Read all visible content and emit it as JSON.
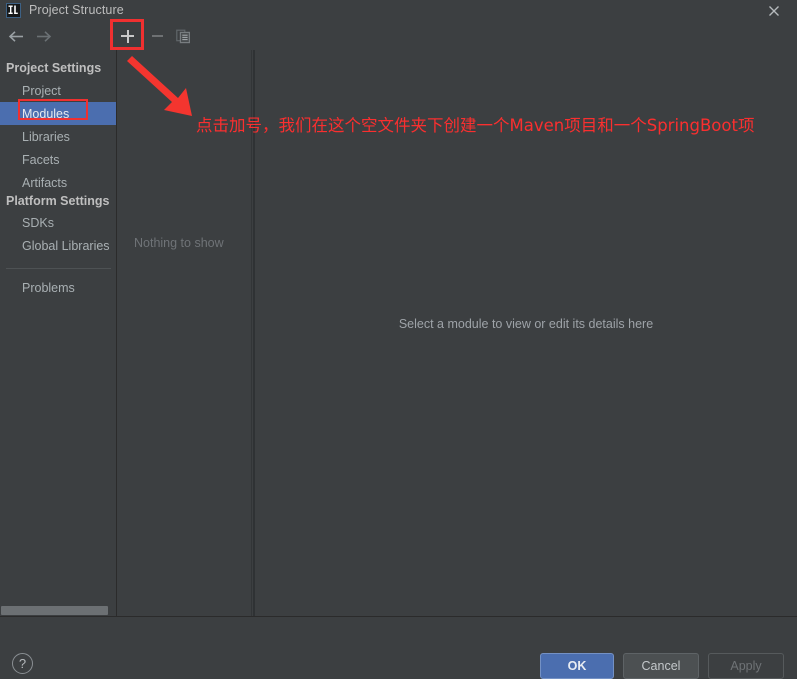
{
  "window": {
    "title": "Project Structure",
    "app_icon": "intellij-idea-icon",
    "close_label": "✕"
  },
  "toolbar": {
    "back_icon": "arrow-left-icon",
    "forward_icon": "arrow-right-icon",
    "add_icon": "plus-icon",
    "remove_icon": "minus-icon",
    "copy_icon": "copy-icon"
  },
  "sidebar": {
    "items": [
      {
        "label": "Project Settings",
        "type": "group",
        "selected": false
      },
      {
        "label": "Project",
        "type": "leaf",
        "selected": false
      },
      {
        "label": "Modules",
        "type": "leaf",
        "selected": true
      },
      {
        "label": "Libraries",
        "type": "leaf",
        "selected": false
      },
      {
        "label": "Facets",
        "type": "leaf",
        "selected": false
      },
      {
        "label": "Artifacts",
        "type": "leaf",
        "selected": false
      },
      {
        "label": "Platform Settings",
        "type": "group",
        "selected": false
      },
      {
        "label": "SDKs",
        "type": "leaf",
        "selected": false
      },
      {
        "label": "Global Libraries",
        "type": "leaf",
        "selected": false
      },
      {
        "label": "Problems",
        "type": "leaf",
        "selected": false
      }
    ]
  },
  "module_list": {
    "empty_text": "Nothing to show"
  },
  "detail_panel": {
    "empty_text": "Select a module to view or edit its details here"
  },
  "annotation": {
    "text": "点击加号，我们在这个空文件夹下创建一个Maven项目和一个SpringBoot项",
    "color": "#fa2f2f",
    "arrow": "red-arrow",
    "highlight_plus": "red-rect-around-add-button",
    "highlight_modules": "red-rect-around-modules-item"
  },
  "footer": {
    "help_label": "?",
    "ok_label": "OK",
    "cancel_label": "Cancel",
    "apply_label": "Apply"
  },
  "colors": {
    "background": "#3c3f41",
    "selection_blue": "#4b6eaf",
    "annotation_red": "#fa2f2f",
    "text": "#bbbbbb"
  }
}
